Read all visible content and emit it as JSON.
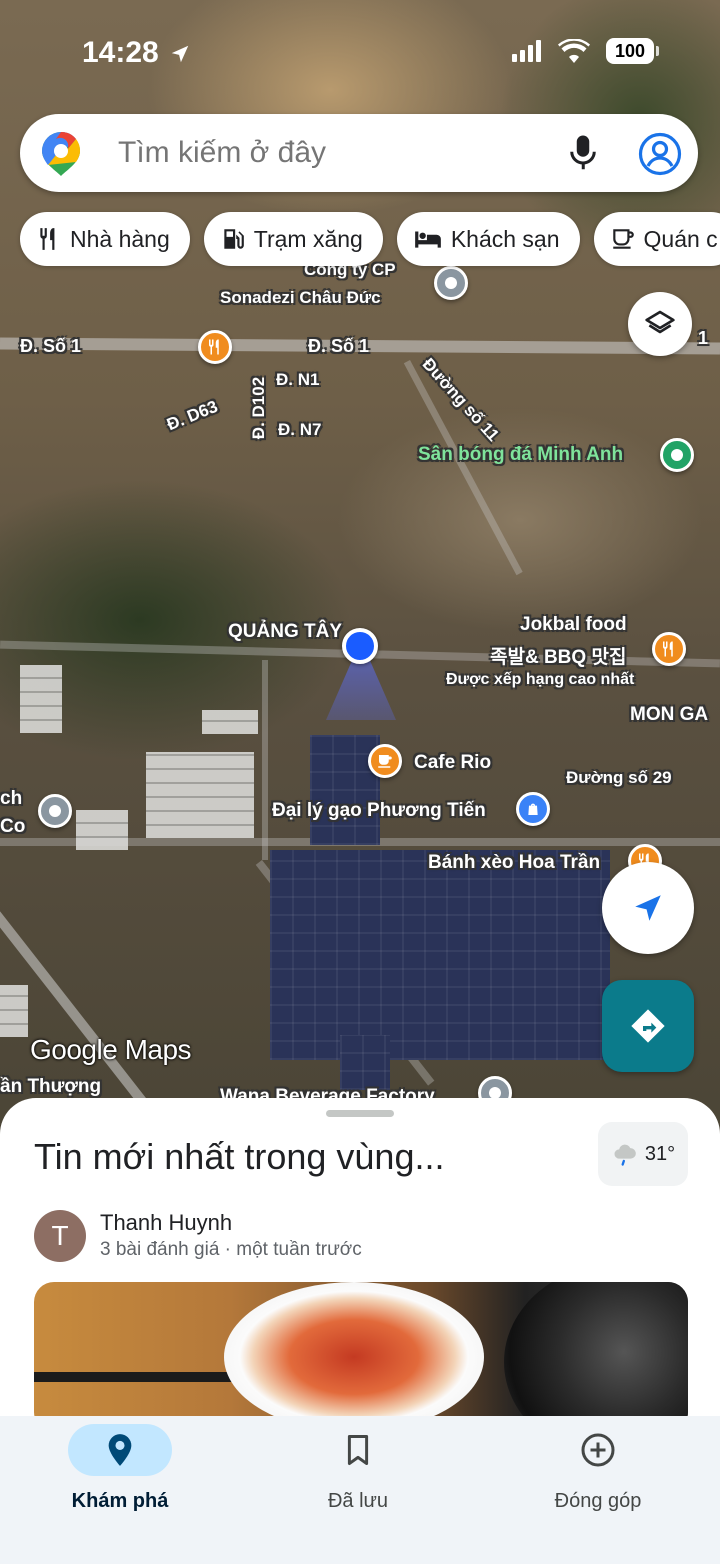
{
  "status_bar": {
    "time": "14:28",
    "battery": "100"
  },
  "search": {
    "placeholder": "Tìm kiếm ở đây"
  },
  "chips": [
    {
      "label": "Nhà hàng",
      "icon": "restaurant-icon"
    },
    {
      "label": "Trạm xăng",
      "icon": "gas-station-icon"
    },
    {
      "label": "Khách sạn",
      "icon": "hotel-icon"
    },
    {
      "label": "Quán c",
      "icon": "cafe-icon"
    }
  ],
  "map": {
    "labels": {
      "cong_ty": "Công ty CP",
      "sonadezi": "Sonadezi Châu Đức",
      "so1_left": "Đ. Số 1",
      "so1_mid": "Đ. Số 1",
      "so1_right": "1",
      "n1": "Đ. N1",
      "d63": "Đ. D63",
      "d102": "Đ. D102",
      "n7": "Đ. N7",
      "duong_so_11": "Đường số 11",
      "san_bong": "Sân bóng đá Minh Anh",
      "quang_tay": "QUẢNG TÂY",
      "jokbal": "Jokbal food",
      "jokbal_kr": "족발& BBQ 맛집",
      "xep_hang": "Được xếp hạng cao nhất",
      "mon_ga": "MON GA",
      "cafe_rio": "Cafe Rio",
      "duong_so_29": "Đường số 29",
      "dai_ly_gao": "Đại lý gạo Phương Tiến",
      "banh_xeo": "Bánh xèo Hoa Trần",
      "ch_co_1": "ch",
      "ch_co_2": "Co",
      "an_thuong": "ần Thượng",
      "wana": "Wana Beverage Factory",
      "google_maps": "Google Maps"
    }
  },
  "sheet": {
    "title": "Tin mới nhất trong vùng...",
    "weather_temp": "31°",
    "avatar_letter": "T",
    "author": "Thanh Huynh",
    "author_meta": "3 bài đánh giá · một tuần trước"
  },
  "nav": [
    {
      "label": "Khám phá",
      "active": true
    },
    {
      "label": "Đã lưu",
      "active": false
    },
    {
      "label": "Đóng góp",
      "active": false
    }
  ],
  "colors": {
    "accent": "#0b7b8b",
    "nav_active": "#c2e7ff",
    "location": "#1a5cff"
  }
}
